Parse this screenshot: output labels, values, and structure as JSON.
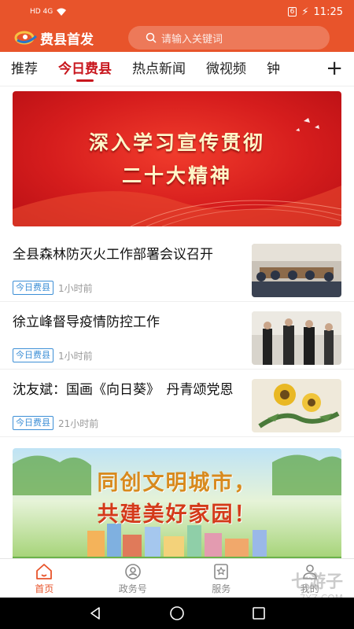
{
  "status_bar": {
    "network": "HD 4G",
    "battery": "6",
    "time": "11:25"
  },
  "header": {
    "app_title": "费县首发",
    "search_placeholder": "请输入关键词"
  },
  "tabs": [
    {
      "label": "推荐",
      "active": false
    },
    {
      "label": "今日费县",
      "active": true
    },
    {
      "label": "热点新闻",
      "active": false
    },
    {
      "label": "微视频",
      "active": false
    },
    {
      "label": "钟",
      "active": false
    }
  ],
  "tab_add_label": "+",
  "banner_top": {
    "line1": "深入学习宣传贯彻",
    "line2": "二十大精神"
  },
  "articles": [
    {
      "title": "全县森林防灭火工作部署会议召开",
      "tag": "今日费县",
      "time": "1小时前"
    },
    {
      "title": "徐立峰督导疫情防控工作",
      "tag": "今日费县",
      "time": "1小时前"
    },
    {
      "title": "沈友斌：国画《向日葵》　丹青颂党恩",
      "tag": "今日费县",
      "time": "21小时前"
    }
  ],
  "banner_bottom": {
    "line1": "同创文明城市，",
    "line2": "共建美好家园！"
  },
  "bottom_nav": [
    {
      "label": "首页",
      "active": true
    },
    {
      "label": "政务号",
      "active": false
    },
    {
      "label": "服务",
      "active": false
    },
    {
      "label": "我的",
      "active": false
    }
  ],
  "watermark": {
    "brand": "七游子",
    "site": "7YZ.COM"
  },
  "colors": {
    "brand": "#e8542b",
    "accent_red": "#c8161d",
    "tag_blue": "#3d8fd6"
  }
}
